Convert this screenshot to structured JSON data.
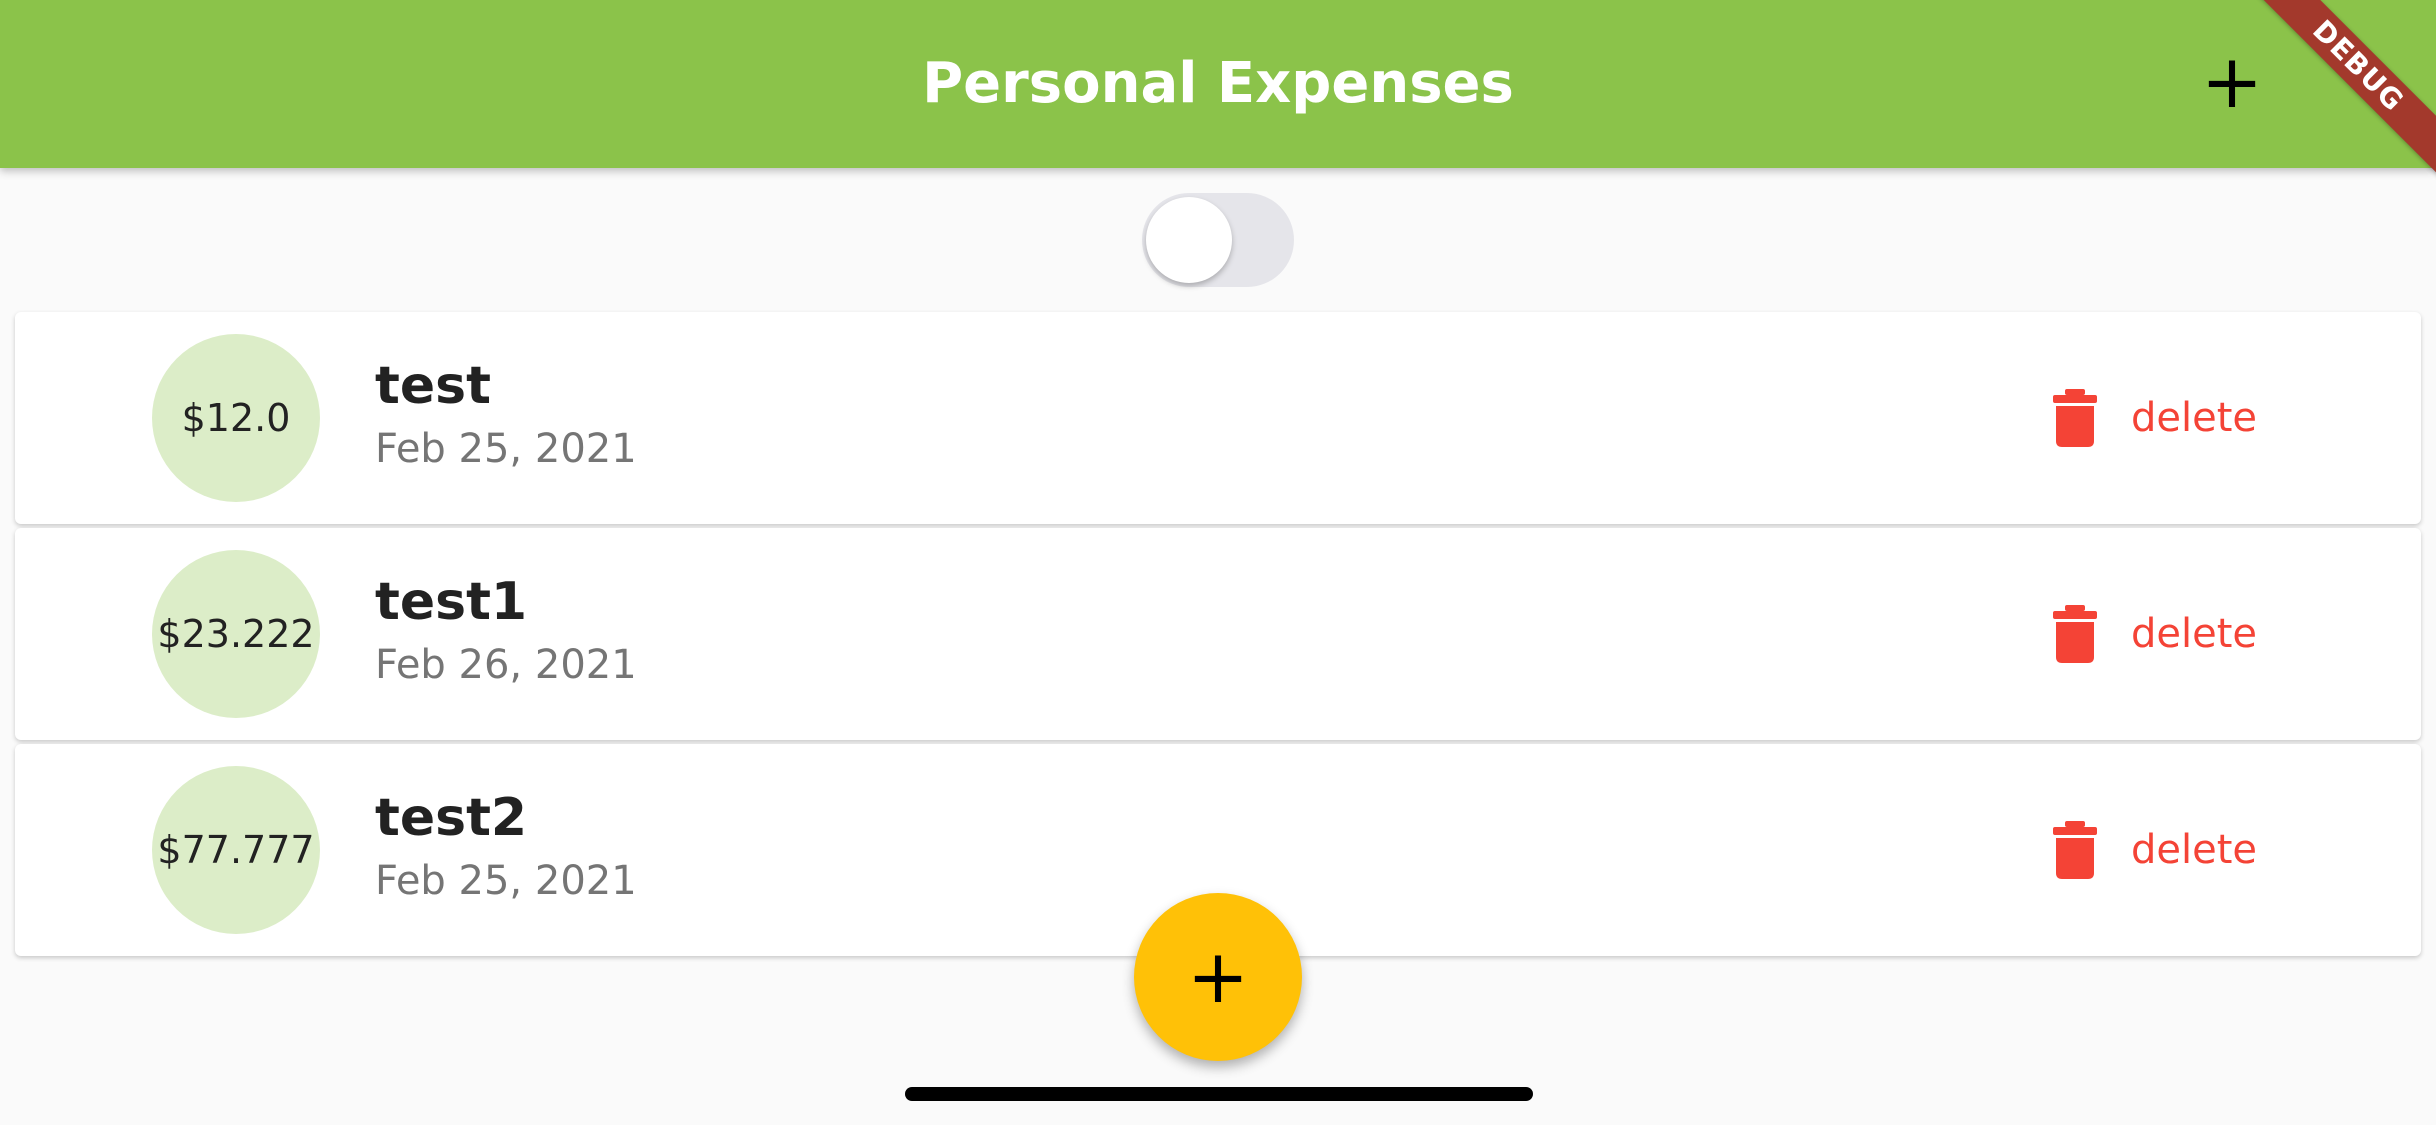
{
  "app_bar": {
    "title": "Personal Expenses",
    "add_icon": "+",
    "add_icon_name": "plus-icon",
    "background_color": "#8bc34a"
  },
  "debug_banner": "DEBUG",
  "chart_toggle": {
    "checked": false
  },
  "transactions": [
    {
      "amount": "$12.0",
      "title": "test",
      "date": "Feb 25, 2021",
      "delete_label": "delete"
    },
    {
      "amount": "$23.222",
      "title": "test1",
      "date": "Feb 26, 2021",
      "delete_label": "delete"
    },
    {
      "amount": "$77.777",
      "title": "test2",
      "date": "Feb 25, 2021",
      "delete_label": "delete"
    }
  ],
  "fab": {
    "icon": "+",
    "icon_name": "plus-icon",
    "color": "#ffc107"
  },
  "colors": {
    "delete": "#f44336",
    "avatar": "#dcedc8"
  }
}
